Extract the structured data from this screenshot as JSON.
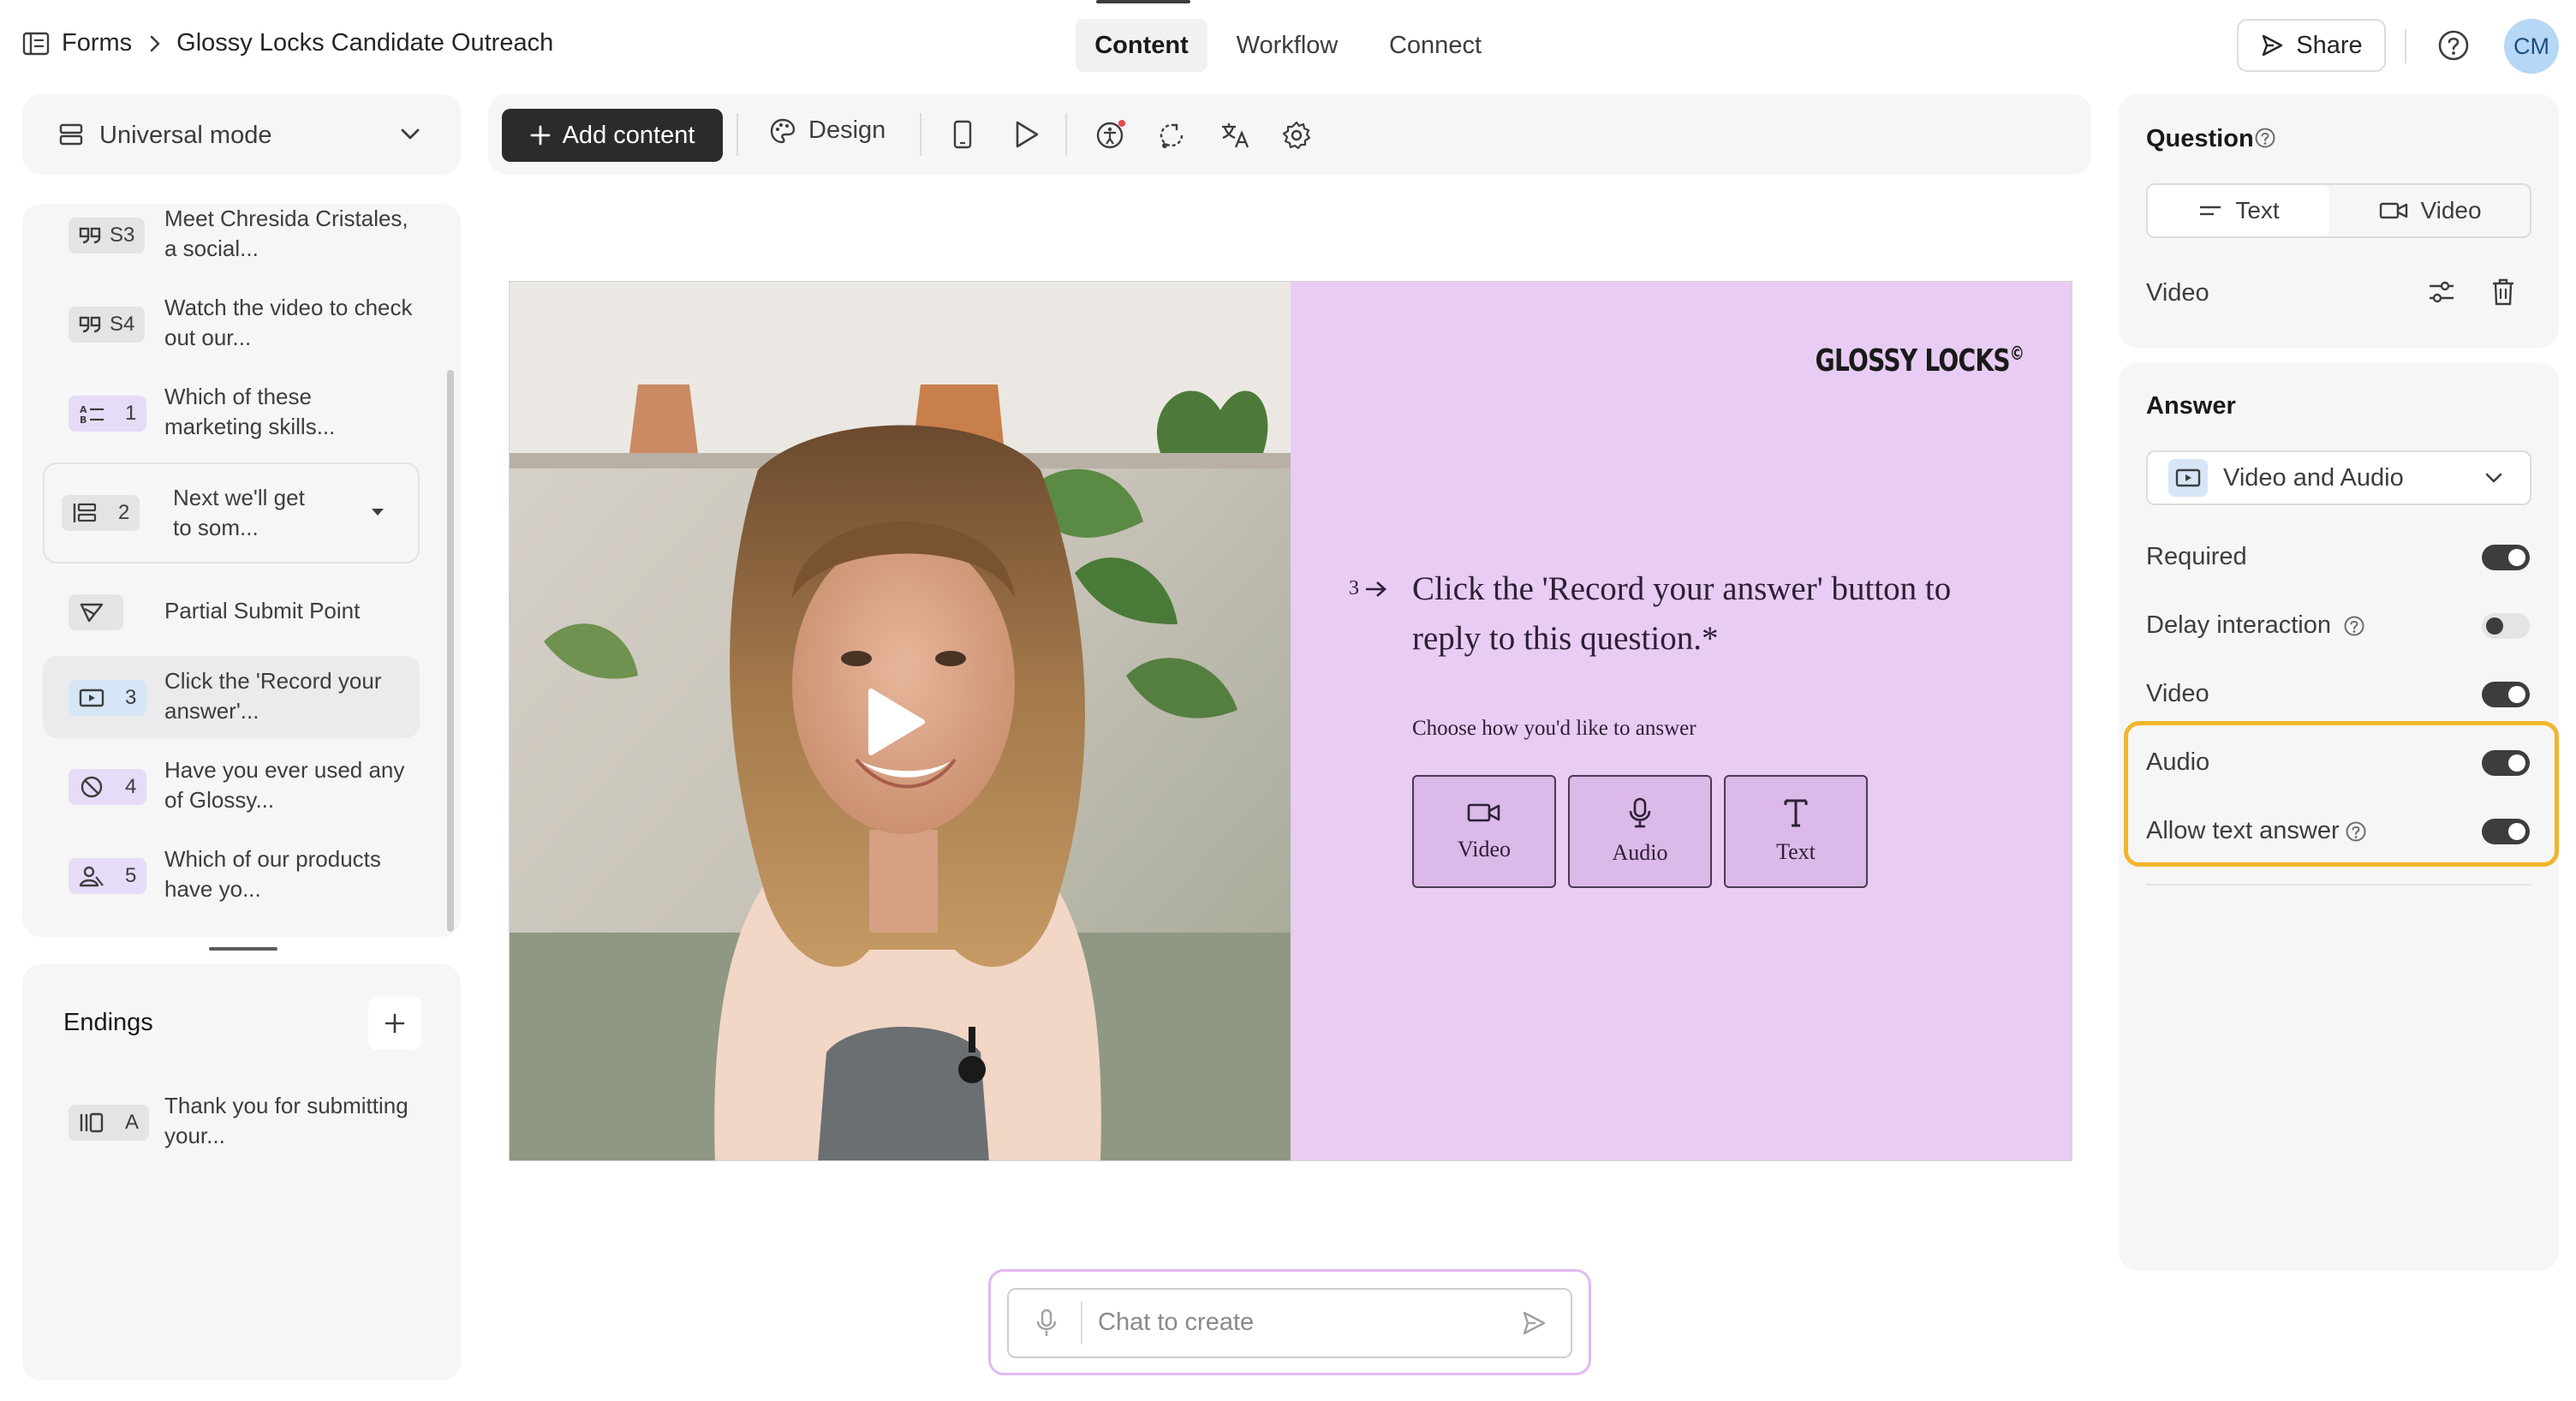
{
  "header": {
    "breadcrumb_root": "Forms",
    "breadcrumb_current": "Glossy Locks Candidate Outreach",
    "tabs": [
      {
        "label": "Content",
        "active": true
      },
      {
        "label": "Workflow",
        "active": false
      },
      {
        "label": "Connect",
        "active": false
      }
    ],
    "share_label": "Share",
    "avatar_initials": "CM"
  },
  "sidebar": {
    "mode_label": "Universal mode",
    "items": [
      {
        "badge": "S3",
        "text": "Meet Chresida Cristales, a social...",
        "icon": "quote-icon",
        "badge_color": "#e4e4e6"
      },
      {
        "badge": "S4",
        "text": "Watch the video to check out our...",
        "icon": "quote-icon",
        "badge_color": "#e4e4e6"
      },
      {
        "badge": "1",
        "text": "Which of these marketing skills...",
        "icon": "multiple-choice-icon",
        "badge_color": "#e6dcf7"
      },
      {
        "badge": "2",
        "text": "Next we'll get to som...",
        "icon": "group-icon",
        "badge_color": "#e4e4e6"
      },
      {
        "badge": "",
        "text": "Partial Submit Point",
        "icon": "partial-submit-icon",
        "badge_color": "#e4e4e6"
      },
      {
        "badge": "3",
        "text": "Click the 'Record your answer'...",
        "icon": "video-question-icon",
        "badge_color": "#d6e6f7"
      },
      {
        "badge": "4",
        "text": "Have you ever used any of Glossy...",
        "icon": "yes-no-icon",
        "badge_color": "#e6dcf7"
      },
      {
        "badge": "5",
        "text": "Which of our products have yo...",
        "icon": "picture-choice-icon",
        "badge_color": "#e6dcf7"
      }
    ],
    "endings_title": "Endings",
    "ending_item": {
      "badge": "A",
      "text": "Thank you for submitting your..."
    }
  },
  "toolbar": {
    "add_content_label": "Add content",
    "design_label": "Design"
  },
  "slide": {
    "logo_text": "GLOSSY LOCKS",
    "logo_mark": "©",
    "question_number": "3",
    "question_text": "Click the 'Record your answer' button to reply to this question.*",
    "choose_text": "Choose how you'd like to answer",
    "answer_options": [
      "Video",
      "Audio",
      "Text"
    ],
    "colors": {
      "content_bg": "#e8ccf3",
      "option_bg": "#dbb9e8"
    }
  },
  "chat": {
    "placeholder": "Chat to create"
  },
  "question_panel": {
    "title": "Question",
    "seg_text": "Text",
    "seg_video": "Video",
    "video_label": "Video"
  },
  "answer_panel": {
    "title": "Answer",
    "select_value": "Video and Audio",
    "toggles": [
      {
        "label": "Required",
        "on": true
      },
      {
        "label": "Delay interaction",
        "on": false
      },
      {
        "label": "Video",
        "on": true
      },
      {
        "label": "Audio",
        "on": true
      },
      {
        "label": "Allow text answer",
        "on": true
      }
    ],
    "highlight_color": "#f2b52a"
  }
}
